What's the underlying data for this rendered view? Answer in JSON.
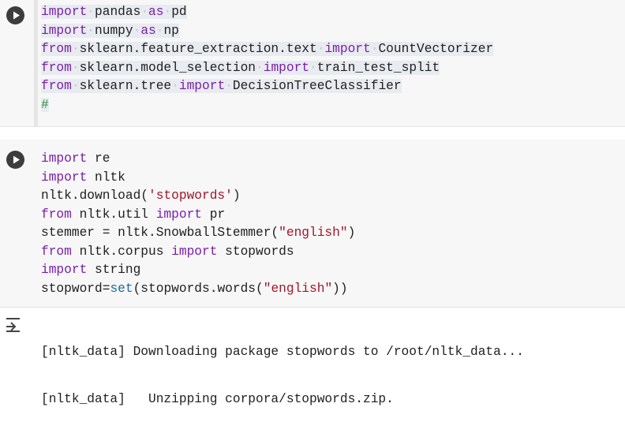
{
  "cell1": {
    "lines": [
      [
        {
          "t": "import",
          "c": "kw"
        },
        {
          "t": "·",
          "c": "ws"
        },
        {
          "t": "pandas",
          "c": "plain"
        },
        {
          "t": "·",
          "c": "ws"
        },
        {
          "t": "as",
          "c": "kw"
        },
        {
          "t": "·",
          "c": "ws"
        },
        {
          "t": "pd",
          "c": "plain"
        }
      ],
      [
        {
          "t": "import",
          "c": "kw"
        },
        {
          "t": "·",
          "c": "ws"
        },
        {
          "t": "numpy",
          "c": "plain"
        },
        {
          "t": "·",
          "c": "ws"
        },
        {
          "t": "as",
          "c": "kw"
        },
        {
          "t": "·",
          "c": "ws"
        },
        {
          "t": "np",
          "c": "plain"
        }
      ],
      [
        {
          "t": "from",
          "c": "kw"
        },
        {
          "t": "·",
          "c": "ws"
        },
        {
          "t": "sklearn.feature_extraction.text",
          "c": "plain"
        },
        {
          "t": "·",
          "c": "ws"
        },
        {
          "t": "import",
          "c": "kw"
        },
        {
          "t": "·",
          "c": "ws"
        },
        {
          "t": "CountVectorizer",
          "c": "plain"
        }
      ],
      [
        {
          "t": "from",
          "c": "kw"
        },
        {
          "t": "·",
          "c": "ws"
        },
        {
          "t": "sklearn.model_selection",
          "c": "plain"
        },
        {
          "t": "·",
          "c": "ws"
        },
        {
          "t": "import",
          "c": "kw"
        },
        {
          "t": "·",
          "c": "ws"
        },
        {
          "t": "train_test_split",
          "c": "plain"
        }
      ],
      [
        {
          "t": "from",
          "c": "kw"
        },
        {
          "t": "·",
          "c": "ws"
        },
        {
          "t": "sklearn.tree",
          "c": "plain"
        },
        {
          "t": "·",
          "c": "ws"
        },
        {
          "t": "import",
          "c": "kw"
        },
        {
          "t": "·",
          "c": "ws"
        },
        {
          "t": "DecisionTreeClassifier",
          "c": "plain"
        }
      ],
      [
        {
          "t": "#",
          "c": "cmt"
        }
      ]
    ]
  },
  "cell2": {
    "lines": [
      [
        {
          "t": "import",
          "c": "kw"
        },
        {
          "t": " re",
          "c": "plain"
        }
      ],
      [
        {
          "t": "import",
          "c": "kw"
        },
        {
          "t": " nltk",
          "c": "plain"
        }
      ],
      [
        {
          "t": "nltk.download(",
          "c": "plain"
        },
        {
          "t": "'stopwords'",
          "c": "str"
        },
        {
          "t": ")",
          "c": "plain"
        }
      ],
      [
        {
          "t": "from",
          "c": "kw"
        },
        {
          "t": " nltk.util ",
          "c": "plain"
        },
        {
          "t": "import",
          "c": "kw"
        },
        {
          "t": " pr",
          "c": "plain"
        }
      ],
      [
        {
          "t": "stemmer = nltk.SnowballStemmer(",
          "c": "plain"
        },
        {
          "t": "\"english\"",
          "c": "str"
        },
        {
          "t": ")",
          "c": "plain"
        }
      ],
      [
        {
          "t": "from",
          "c": "kw"
        },
        {
          "t": " nltk.corpus ",
          "c": "plain"
        },
        {
          "t": "import",
          "c": "kw"
        },
        {
          "t": " stopwords",
          "c": "plain"
        }
      ],
      [
        {
          "t": "import",
          "c": "kw"
        },
        {
          "t": " string",
          "c": "plain"
        }
      ],
      [
        {
          "t": "stopword=",
          "c": "plain"
        },
        {
          "t": "set",
          "c": "fn"
        },
        {
          "t": "(stopwords.words(",
          "c": "plain"
        },
        {
          "t": "\"english\"",
          "c": "str"
        },
        {
          "t": "))",
          "c": "plain"
        }
      ]
    ]
  },
  "output": {
    "lines": [
      "[nltk_data] Downloading package stopwords to /root/nltk_data...",
      "[nltk_data]   Unzipping corpora/stopwords.zip."
    ]
  },
  "colors": {
    "keyword": "#7a1fa8",
    "string": "#a3162b",
    "comment": "#2f8a3c",
    "builtin": "#1a6b9f"
  },
  "icons": {
    "run": "play-circle-icon",
    "output": "output-collapse-icon"
  }
}
